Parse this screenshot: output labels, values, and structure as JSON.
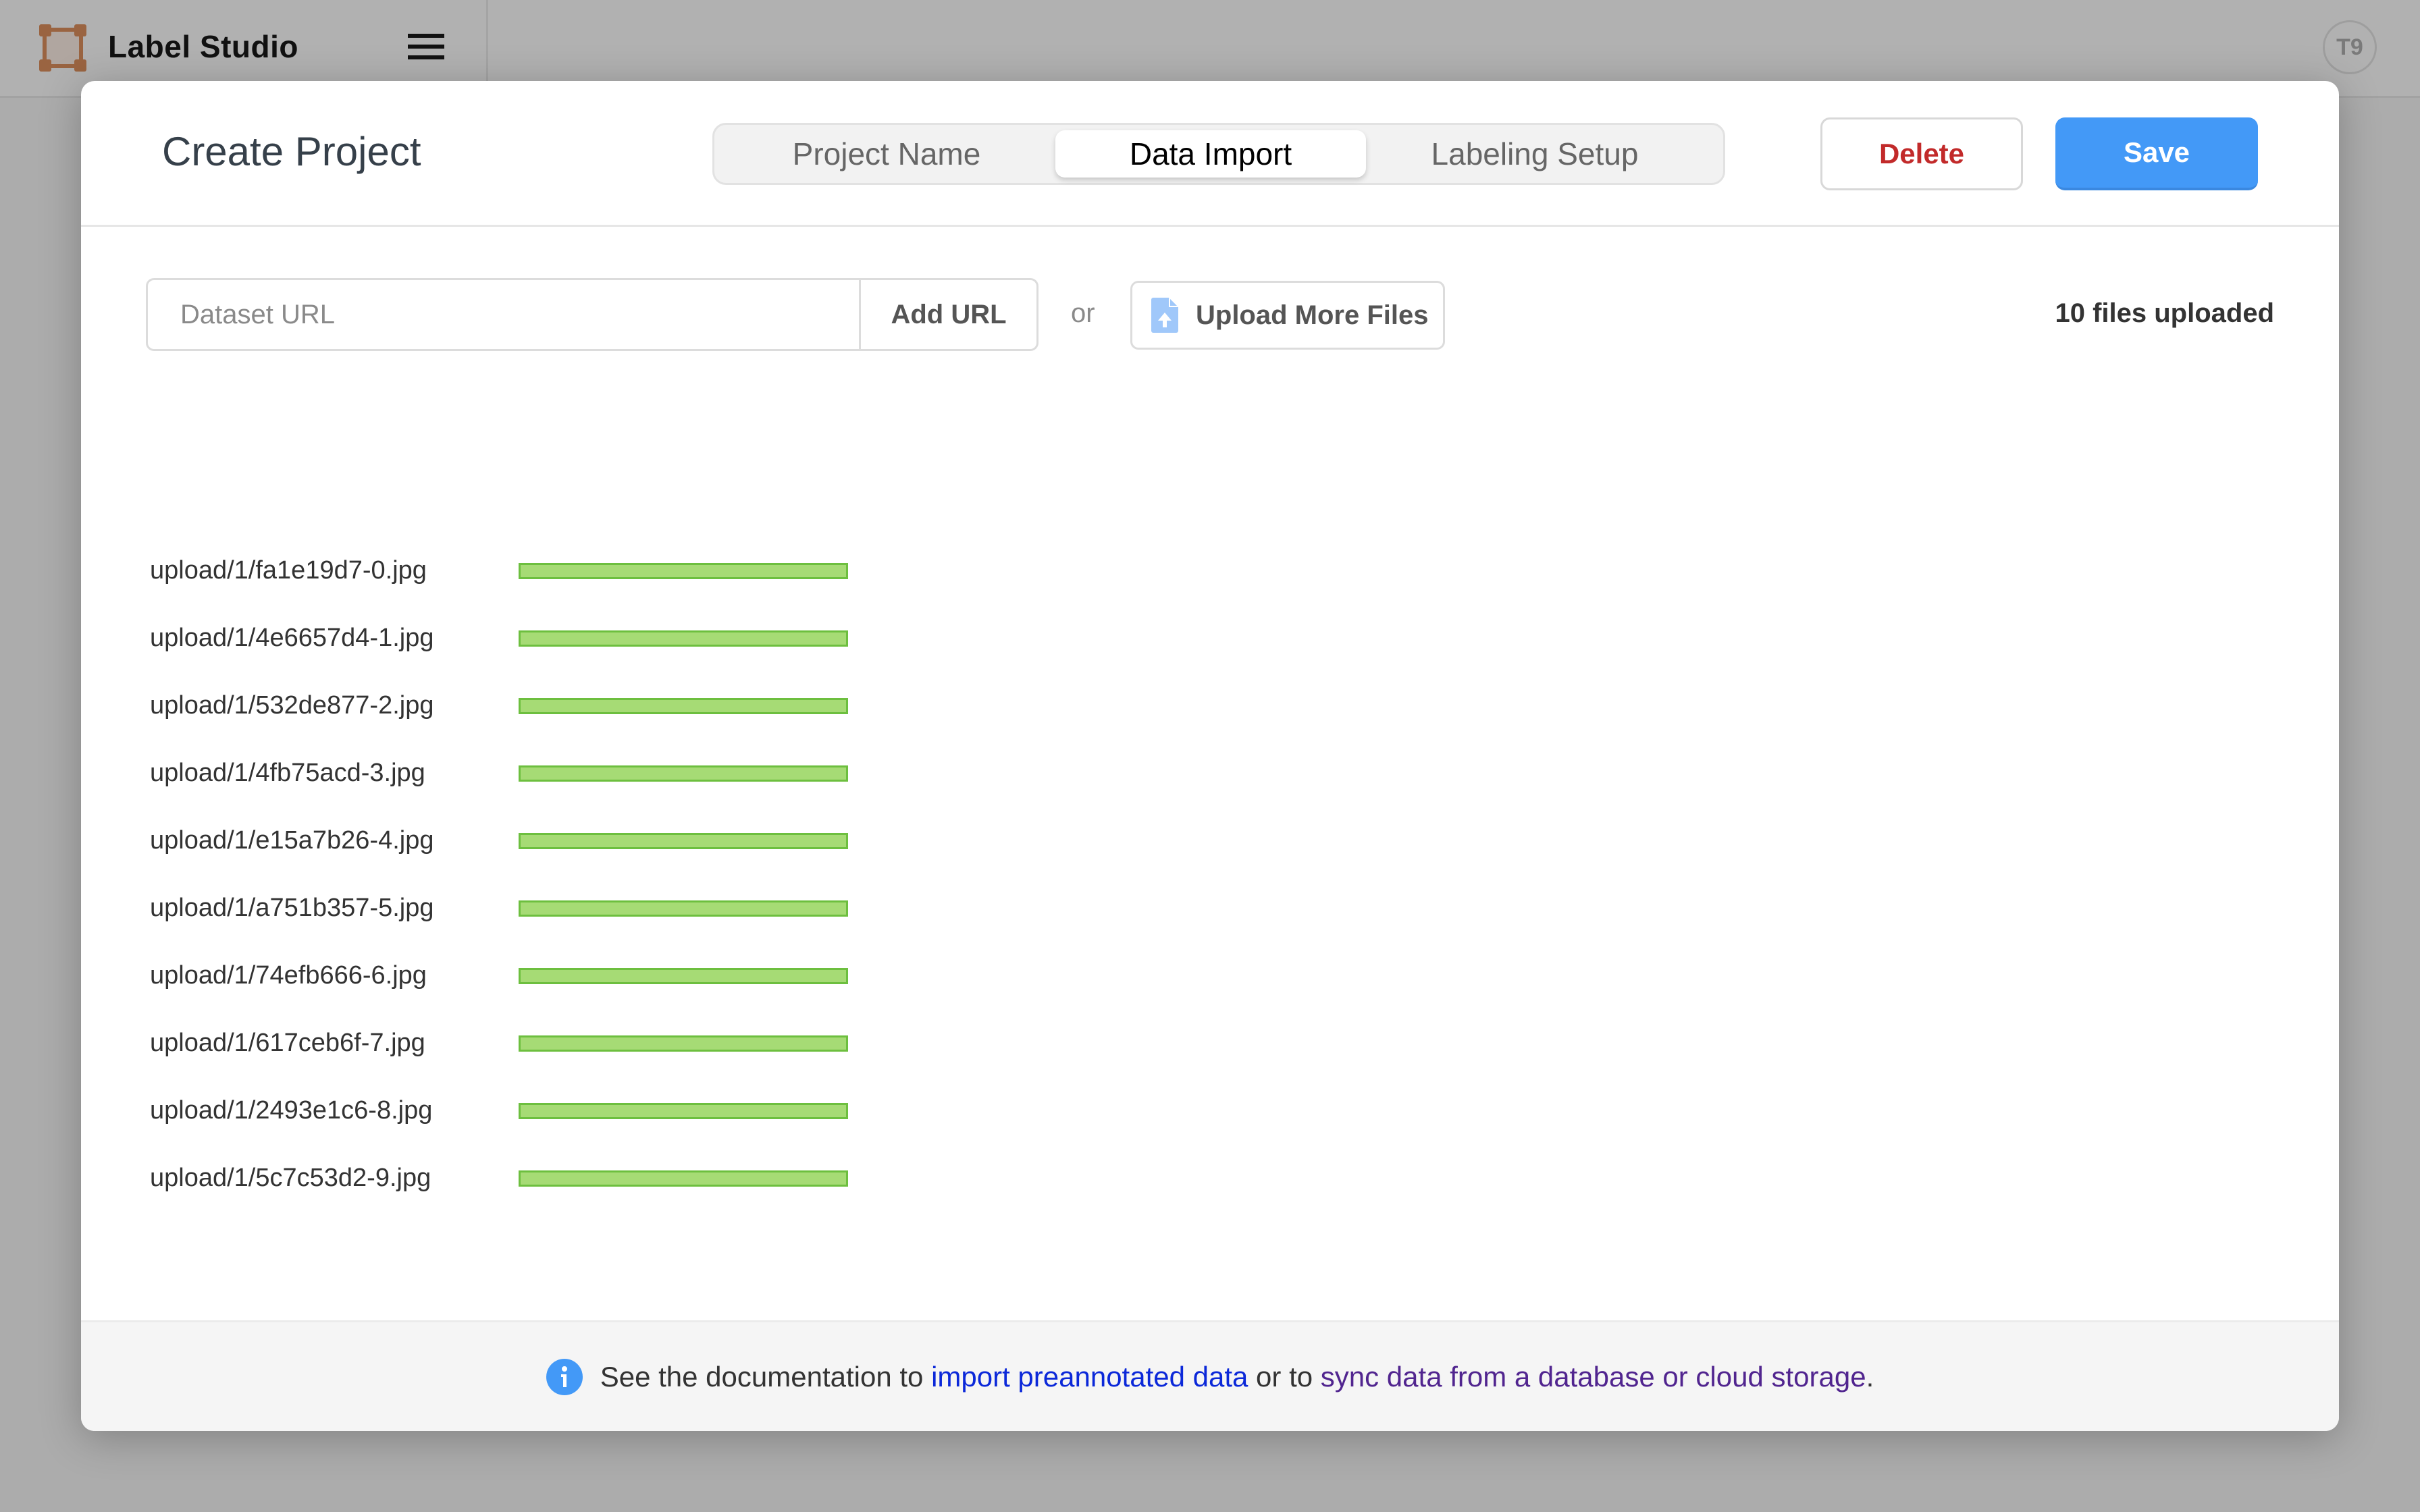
{
  "app": {
    "title": "Label Studio",
    "avatar_initials": "T9"
  },
  "modal": {
    "title": "Create Project",
    "tabs": [
      {
        "label": "Project Name",
        "active": false
      },
      {
        "label": "Data Import",
        "active": true
      },
      {
        "label": "Labeling Setup",
        "active": false
      }
    ],
    "delete_label": "Delete",
    "save_label": "Save"
  },
  "import": {
    "url_placeholder": "Dataset URL",
    "url_value": "",
    "add_url_label": "Add URL",
    "or_label": "or",
    "upload_label": "Upload More Files",
    "files_count": "10 files uploaded"
  },
  "files": [
    {
      "name": "upload/1/fa1e19d7-0.jpg",
      "progress": 1.0
    },
    {
      "name": "upload/1/4e6657d4-1.jpg",
      "progress": 1.0
    },
    {
      "name": "upload/1/532de877-2.jpg",
      "progress": 1.0
    },
    {
      "name": "upload/1/4fb75acd-3.jpg",
      "progress": 1.0
    },
    {
      "name": "upload/1/e15a7b26-4.jpg",
      "progress": 1.0
    },
    {
      "name": "upload/1/a751b357-5.jpg",
      "progress": 1.0
    },
    {
      "name": "upload/1/74efb666-6.jpg",
      "progress": 1.0
    },
    {
      "name": "upload/1/617ceb6f-7.jpg",
      "progress": 1.0
    },
    {
      "name": "upload/1/2493e1c6-8.jpg",
      "progress": 1.0
    },
    {
      "name": "upload/1/5c7c53d2-9.jpg",
      "progress": 1.0
    }
  ],
  "footer": {
    "prefix": "See the documentation to ",
    "link1": "import preannotated data",
    "middle": " or to ",
    "link2": "sync data from a database or cloud storage",
    "suffix": "."
  },
  "colors": {
    "accent": "#4399f7",
    "danger": "#c22a2a",
    "progress_fill": "#a6db75",
    "progress_border": "#6dbf3f",
    "logo": "#9a6441"
  }
}
